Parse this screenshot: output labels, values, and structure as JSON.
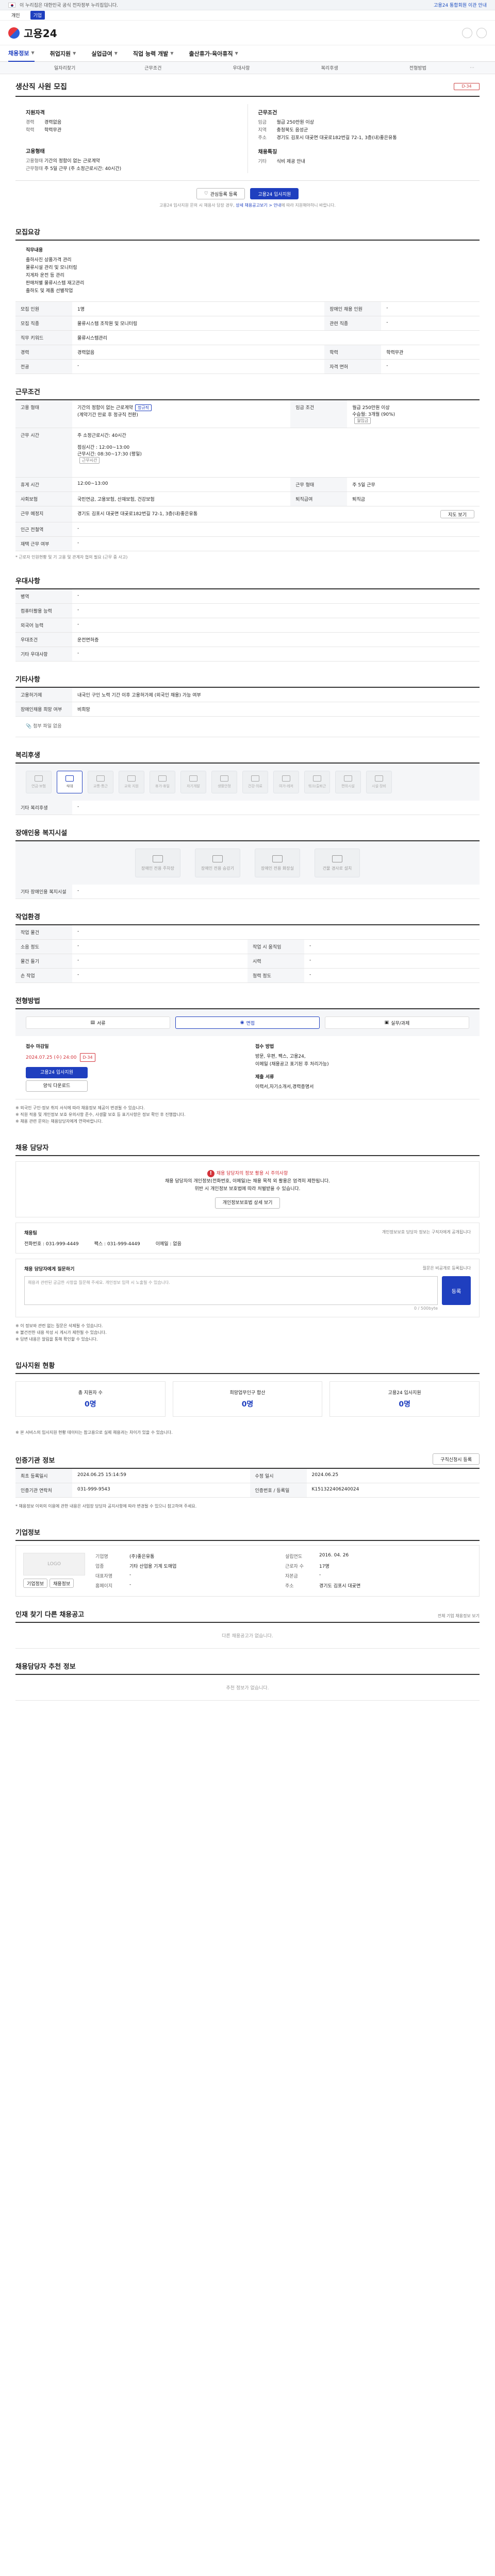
{
  "gov_bar": {
    "text": "이 누리집은 대한민국 공식 전자정부 누리집입니다.",
    "notice": "고용24 통합회원 이관 안내"
  },
  "topbar": {
    "tabs": [
      "개인",
      "기업"
    ],
    "active": 1
  },
  "header": {
    "logo": "고용24"
  },
  "gnb": {
    "items": [
      "채용정보",
      "취업지원",
      "실업급여",
      "직업 능력 개발",
      "출산휴가·육아휴직"
    ]
  },
  "sub_nav": {
    "items": [
      "일자리찾기",
      "근무조건",
      "우대사항",
      "복리후생",
      "전형방법"
    ]
  },
  "job": {
    "title": "생산직 사원 모집",
    "ribbon": "D-34",
    "left": {
      "h1": "지원자격",
      "rows": [
        [
          "경력",
          "경력없음"
        ],
        [
          "학력",
          "학력무관"
        ]
      ],
      "h2": "고용형태",
      "rows2": [
        [
          "고용형태",
          "기간의 정함이 없는 근로계약"
        ],
        [
          "근무형태",
          "주 5일 근무 (주 소정근로시간: 40시간)"
        ]
      ]
    },
    "right": {
      "h1": "근무조건",
      "rows": [
        [
          "임금",
          "월급 250만원 이상"
        ],
        [
          "지역",
          "충청북도 음성군"
        ],
        [
          "주소",
          "경기도 김포시 대곶면 대곶로182번길 72-1, 3층(내)좋은유통"
        ]
      ],
      "h2": "채용특징",
      "rows2": [
        [
          "기타",
          "식비 제공 안내"
        ]
      ]
    },
    "btn_interest": "관심등록 등록",
    "btn_apply": "고용24 입사지원",
    "note": "고용24 입사지원 문의 시 채용사 답장 경우,",
    "note_link": "상세 채용공고보기 > 안내",
    "note_tail": "에 따라 지원해야하니 바랍니다."
  },
  "recruit": {
    "title": "모집요강",
    "desc_sub": "직무내용",
    "desc": [
      "출하사진 상품가격 관리",
      "물류시설 관리 및 모니터링",
      "지게차 운전 등 관리",
      "판매처별 물류시스템 재고관리",
      "출하도 및 제품 선별작업"
    ],
    "table": [
      [
        "모집 인원",
        "1명",
        "장애인 채용 인원",
        "-"
      ],
      [
        "모집 직종",
        "물류시스템 조작원 및 모니터링",
        "관련 직종",
        "-"
      ],
      [
        "직무 키워드",
        "물류시스템관리",
        "",
        ""
      ],
      [
        "경력",
        "경력없음",
        "학력",
        "학력무관"
      ],
      [
        "전공",
        "-",
        "자격 면허",
        "-"
      ]
    ]
  },
  "conditions": {
    "title": "근무조건",
    "rows": {
      "emp_type_k": "고용 형태",
      "emp_type_v": "기간의 정함이 없는 근로계약",
      "emp_type_tag": "정규직",
      "emp_type_sub": "(계약기간 만료 후 정규직 전환)",
      "pay_k": "임금 조건",
      "pay_v": "월급 250만원 이상",
      "pay_sub": "수습월: 3개월 (90%)",
      "pay_tag": "월임금",
      "time_k": "근무 시간",
      "time_v1": "주 소정근로시간: 40시간",
      "time_v2": "점심시간 : 12:00~13:00",
      "time_v3": "근무시간: 08:30~17:30 (평일)",
      "time_tag": "근무시간",
      "shift_k": "휴게 시간",
      "shift_v": "12:00~13:00",
      "day_k": "근무 형태",
      "day_v": "주 5일 근무",
      "ins_k": "사회보험",
      "ins_v": "국민연금, 고용보험, 산재보험, 건강보험",
      "ret_k": "퇴직급여",
      "ret_v": "퇴직금",
      "addr_k": "근무 예정지",
      "addr_v": "경기도 김포시 대곶면 대곶로182번길 72-1, 3층(내)좋은유통",
      "addr_btn": "지도 보기",
      "near_k": "인근 전철역",
      "near_v": "-",
      "env_k": "재택 근무 여부",
      "env_v": "-"
    },
    "note": "* 근로자 인원현황 및 기 고용 및 관계자 협의 필요 (근무 중 사고)"
  },
  "pref": {
    "title": "우대사항",
    "rows": [
      [
        "병역",
        "-"
      ],
      [
        "컴퓨터활용 능력",
        "-"
      ],
      [
        "외국어 능력",
        "-"
      ],
      [
        "우대조건",
        "운전면허증"
      ],
      [
        "기타 우대사항",
        "-"
      ]
    ]
  },
  "other": {
    "title": "기타사항",
    "rows": [
      [
        "고용허가제",
        "내국인 구인 노력 기간 이후 고용허가제 (외국인 채용) 가능 여부"
      ],
      [
        "장애인채용 희망 여부",
        "비희망"
      ]
    ],
    "attach": "첨부 파일 없음"
  },
  "welfare": {
    "title": "복리후생",
    "items": [
      "연금·보험",
      "식대",
      "교통·통근",
      "교육 지원",
      "휴가·휴일",
      "자기개발",
      "생활안정",
      "건강·의료",
      "여가·레저",
      "워크/출퇴근",
      "편의시설",
      "시설·장비"
    ],
    "on_index": 1,
    "extra_k": "기타 복리후생",
    "extra_v": "-"
  },
  "disability": {
    "title": "장애인용 복지시설",
    "items": [
      "장애인 전용 주차장",
      "장애인 전용 승강기",
      "장애인 전용 화장실",
      "건물 경사로 설치"
    ],
    "extra_k": "기타 장애인용 복지시설",
    "extra_v": "-"
  },
  "workenv": {
    "title": "작업환경",
    "rows": [
      [
        "작업 물건",
        "-",
        "",
        ""
      ],
      [
        "소음 정도",
        "-",
        "작업 시 움직임",
        "-"
      ],
      [
        "물건 들기",
        "-",
        "시력",
        "-"
      ],
      [
        "손 작업",
        "-",
        "청력 정도",
        "-"
      ]
    ]
  },
  "method": {
    "title": "전형방법",
    "tabs": [
      "서류",
      "면접",
      "실무/과제"
    ],
    "deadline_h": "접수 마감일",
    "deadline_v": "2024.07.25 (수) 24:00",
    "deadline_tag": "D-34",
    "receive_h": "접수 방법",
    "receive_v1": "방문, 우편, 팩스, 고용24,",
    "receive_v2": "이메일 (채용공고 표기된 후 처리가능)",
    "apply_btn": "고용24 입사지원",
    "print_btn": "양식 다운로드",
    "docs_h": "제출 서류",
    "docs_v": "이력서,자기소개서,경력증명서",
    "bullets": [
      "※ 외국인 구인·정보 취지 서식에 따라 채용정보 제공이 변경될 수 있습니다.",
      "※ 직원 적용 및 개인정보 보호 유의사항 준수, 사생활 보호 등 표기사항은 정보 확인 후 진행합니다.",
      "※ 채용 관련 문의는 채용담당자에게 연락바랍니다."
    ]
  },
  "manager": {
    "title": "채용 담당자",
    "warn1": "채용 담당자의 정보 활용 시 주의사항",
    "warn2": "채용 담당자의 개인정보(전화번호, 이메일)는 채용 목적 외 활용은 엄격히 제한됩니다.",
    "warn3": "위반 시 개인정보 보호법에 따라 처벌받을 수 있습니다.",
    "warn_btn": "개인정보보호법 상세 보기",
    "box_h": "채용팀",
    "box_note": "개인정보보호 담당자 정보는 구직자에게 공개됩니다",
    "phone": "전화번호 : 031-999-4449",
    "fax": "팩스 : 031-999-4449",
    "mail": "이메일 : 없음"
  },
  "qa": {
    "title": "채용 담당자에게 질문하기",
    "note": "질문은 비공개로 등록됩니다",
    "placeholder": "채용과 관련된 궁금한 사항을 질문해 주세요. 개인정보 입력 시 노출될 수 있습니다.",
    "count": "0 / 500byte",
    "btn": "등록",
    "bullets": [
      "※ 이 정보와 관련 없는 질문은 삭제될 수 있습니다.",
      "※ 불건전한 내용 작성 시 게시가 제한될 수 있습니다.",
      "※ 답변 내용은 알림을 통해 확인할 수 있습니다."
    ]
  },
  "stats": {
    "title": "입사지원 현황",
    "items": [
      [
        "총 지원자 수",
        "0명"
      ],
      [
        "희망업무인구 합산",
        "0명"
      ],
      [
        "고용24 입사지원",
        "0명"
      ]
    ],
    "note": "※ 본 서비스의 입사지원 현황 데이터는 참고용으로 실제 채용과는 차이가 있을 수 있습니다."
  },
  "info": {
    "title": "인증기관 정보",
    "btn": "구직신청시 등록",
    "rows": [
      [
        "최초 등록일시",
        "2024.06.25 15:14:59",
        "수정 일시",
        "2024.06.25"
      ],
      [
        "인증기관 연락처",
        "031-999-9543",
        "인증번호 / 등록일",
        "K151322406240024"
      ]
    ],
    "note": "* 채용정보 이외의 이용에 관한 내용은 사업장 담당자 공지사항에 따라 변경될 수 있으니 참고하여 주세요."
  },
  "company": {
    "title": "기업정보",
    "logo": "LOGO",
    "fields": [
      [
        "기업명",
        "(주)좋은유통",
        "설립연도",
        "2016. 04. 26"
      ],
      [
        "업종",
        "기타 산업용 기계 도매업",
        "근로자 수",
        "17명"
      ],
      [
        "대표자명",
        "-",
        "자본금",
        "-"
      ],
      [
        "홈페이지",
        "-",
        "주소",
        "경기도 김포시 대곶면"
      ]
    ],
    "btn1": "기업정보",
    "btn2": "채용정보"
  },
  "related": {
    "title": "인재 찾기 다른 채용공고",
    "link": "전체 기업 채용정보 보기",
    "empty": "다른 채용공고가 없습니다."
  },
  "recommend": {
    "title": "채용담당자 추천 정보",
    "empty": "추천 정보가 없습니다."
  }
}
